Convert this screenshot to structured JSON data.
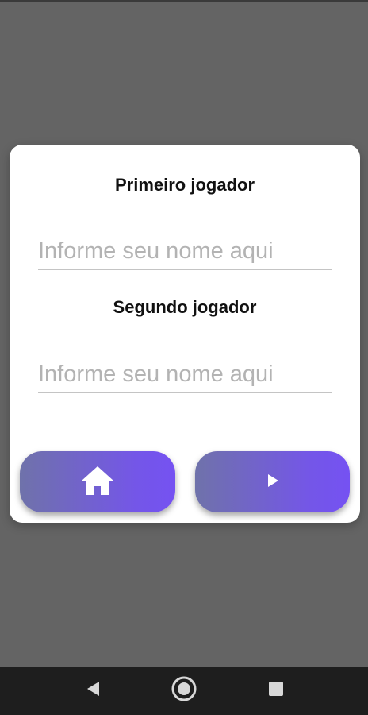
{
  "dialog": {
    "first_player_label": "Primeiro jogador",
    "first_player_placeholder": "Informe seu nome aqui",
    "first_player_value": "",
    "second_player_label": "Segundo jogador",
    "second_player_placeholder": "Informe seu nome aqui",
    "second_player_value": "",
    "buttons": {
      "home_icon": "home-icon",
      "play_icon": "play-icon",
      "gradient_start": "#6f72aa",
      "gradient_end": "#7552f2"
    }
  },
  "system_nav": {
    "back_icon": "back-triangle-icon",
    "home_icon": "home-circle-icon",
    "recents_icon": "recents-square-icon"
  },
  "colors": {
    "backdrop": "#646464",
    "dialog_background": "#ffffff",
    "nav_bar": "#1e1e1e"
  }
}
